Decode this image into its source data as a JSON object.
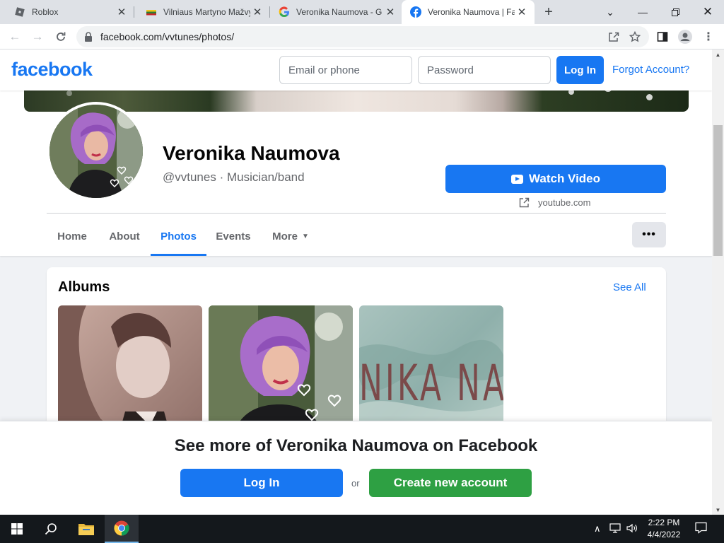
{
  "browser": {
    "tabs": [
      {
        "title": "Roblox",
        "icon": "roblox-icon",
        "active": false
      },
      {
        "title": "Vilniaus Martyno Mažvy",
        "icon": "library-favicon",
        "active": false
      },
      {
        "title": "Veronika Naumova - G",
        "icon": "google-icon",
        "active": false
      },
      {
        "title": "Veronika Naumova | Fa",
        "icon": "facebook-icon",
        "active": true
      }
    ],
    "url": "facebook.com/vvtunes/photos/"
  },
  "header": {
    "logo": "facebook",
    "email_placeholder": "Email or phone",
    "password_placeholder": "Password",
    "login_label": "Log In",
    "forgot_label": "Forgot Account?"
  },
  "profile": {
    "name": "Veronika Naumova",
    "subtitle": "@vvtunes · Musician/band",
    "cta_label": "Watch Video",
    "cta_link": "youtube.com",
    "tabs": [
      "Home",
      "About",
      "Photos",
      "Events",
      "More"
    ],
    "active_tab": "Photos"
  },
  "albums": {
    "title": "Albums",
    "see_all": "See All",
    "items": [
      {
        "name": "album-1",
        "text": ""
      },
      {
        "name": "album-2",
        "text": ""
      },
      {
        "name": "album-3",
        "text": "NIKA NAU"
      }
    ]
  },
  "login_prompt": {
    "headline": "See more of Veronika Naumova on Facebook",
    "login_label": "Log In",
    "or_label": "or",
    "create_label": "Create new account"
  },
  "taskbar": {
    "time": "2:22 PM",
    "date": "4/4/2022"
  },
  "colors": {
    "fb_blue": "#1877f2",
    "fb_green": "#2ea043",
    "taskbar": "#14181c"
  }
}
